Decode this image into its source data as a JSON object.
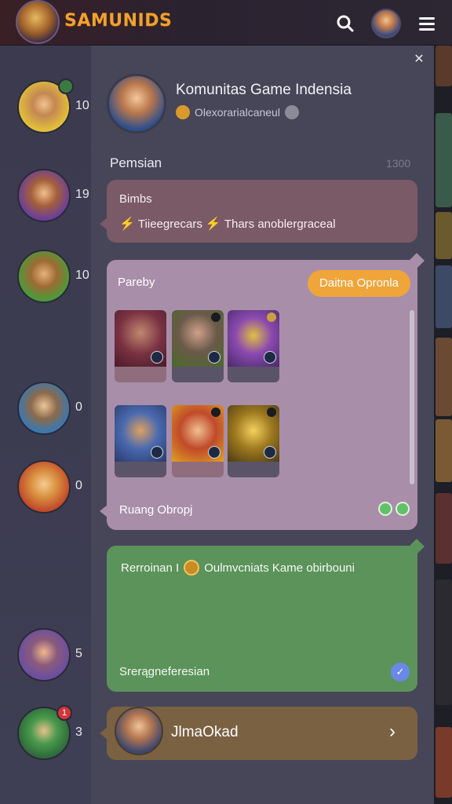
{
  "app": {
    "title": "SAMUNIDS"
  },
  "header": {
    "title": "Komunitas Game Indensia",
    "subtitle": "Olexorarialcaneul"
  },
  "section": {
    "label": "Pemsian",
    "count": "1300"
  },
  "sidebar": {
    "items": [
      {
        "count": "10"
      },
      {
        "count": "19"
      },
      {
        "count": "10"
      },
      {
        "count": "0"
      },
      {
        "count": "0"
      },
      {
        "count": "5"
      },
      {
        "count": "3"
      }
    ],
    "notification_badge": "1"
  },
  "cards": {
    "card1": {
      "title": "Bimbs",
      "line_a": "Tiieegrecars",
      "line_b": "Thars anoblergraceal"
    },
    "card2": {
      "title": "Pareby",
      "pill": "Daitna Opronla",
      "footer": "Ruang Obropj"
    },
    "card3": {
      "title_a": "Rerroinan I",
      "title_b": "Oulmvcniats Kame obirbouni",
      "footer": "Srerągneferesian"
    },
    "card4": {
      "name": "JlmaOkad"
    }
  },
  "colors": {
    "accent": "#f0a53a",
    "logo": "#f0a12e",
    "card_purple": "#a88ea9",
    "card_green": "#5b935a",
    "card_brown": "#7a6142"
  },
  "icons": {
    "search": "search-icon",
    "menu": "hamburger-icon",
    "close": "close-icon",
    "chevron": "chevron-right-icon"
  }
}
